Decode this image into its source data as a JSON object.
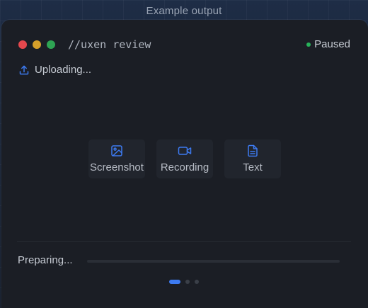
{
  "caption": "Example output",
  "window": {
    "title": "//uxen review",
    "status": "Paused",
    "upload_label": "Uploading..."
  },
  "options": [
    {
      "label": "Screenshot",
      "icon": "image-icon"
    },
    {
      "label": "Recording",
      "icon": "video-camera-icon"
    },
    {
      "label": "Text",
      "icon": "document-icon"
    }
  ],
  "footer": {
    "preparing_label": "Preparing...",
    "progress": 0.0,
    "pages": 3,
    "active_page": 1
  },
  "colors": {
    "accent": "#3d7bf2",
    "status_dot": "#27b35a",
    "traffic_red": "#e5484d",
    "traffic_yellow": "#d6a02a",
    "traffic_green": "#2ea453"
  }
}
